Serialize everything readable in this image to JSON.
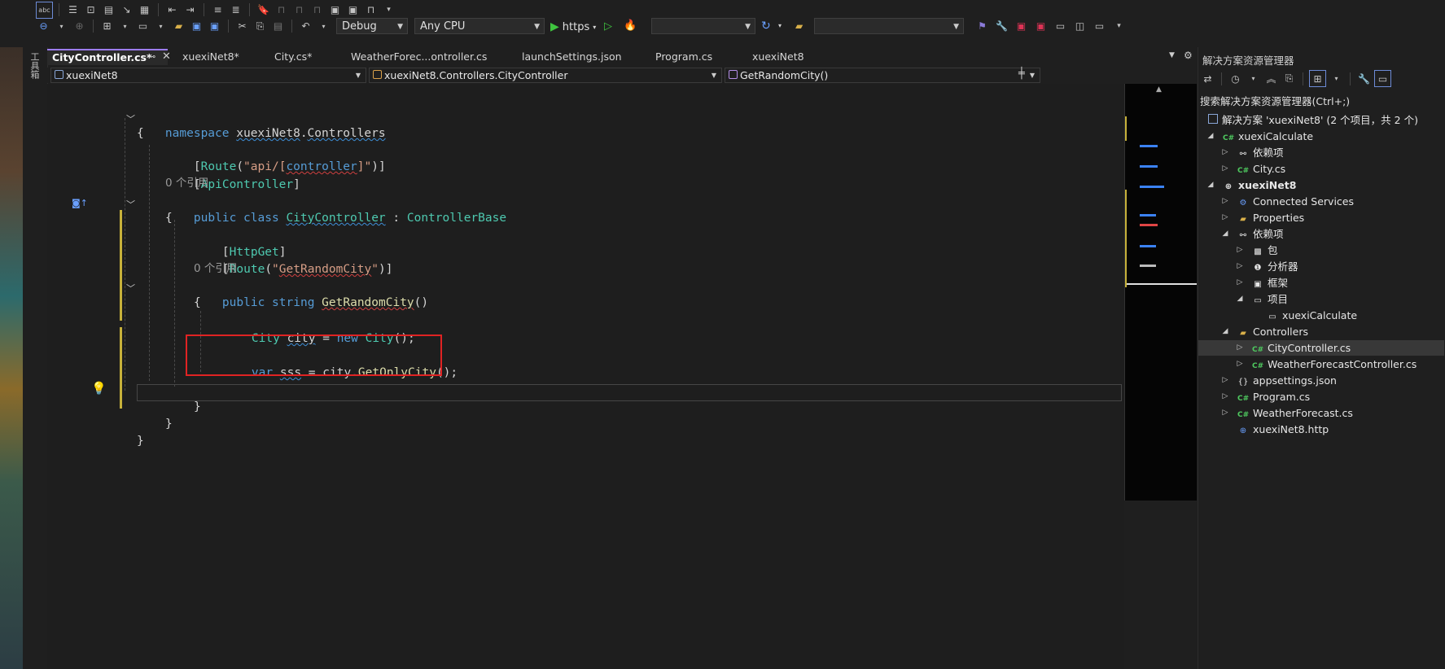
{
  "toolbar": {
    "config": "Debug",
    "platform": "Any CPU",
    "run_label": "https",
    "startup_combo": "",
    "search_combo": ""
  },
  "toolbox_label": "工具箱",
  "tabs": [
    {
      "label": "CityController.cs*",
      "active": true
    },
    {
      "label": "xuexiNet8*"
    },
    {
      "label": "City.cs*"
    },
    {
      "label": "WeatherForec...ontroller.cs"
    },
    {
      "label": "launchSettings.json"
    },
    {
      "label": "Program.cs"
    },
    {
      "label": "xuexiNet8"
    }
  ],
  "navbar": {
    "project": "xuexiNet8",
    "class": "xuexiNet8.Controllers.CityController",
    "member": "GetRandomCity()"
  },
  "code": {
    "l1_kw": "namespace",
    "l1_ns1": "xuexiNet8",
    "l1_dot": ".",
    "l1_ns2": "Controllers",
    "l2": "{",
    "l3_open": "[",
    "l3_attr": "Route",
    "l3_p1": "(",
    "l3_s1": "\"api/[",
    "l3_s2": "controller",
    "l3_s3": "]\"",
    "l3_close": ")]",
    "l4_open": "[",
    "l4_attr": "ApiController",
    "l4_close": "]",
    "l5_ref": "0 个引用",
    "l6_kw1": "public",
    "l6_kw2": "class",
    "l6_name": "CityController",
    "l6_colon": " : ",
    "l6_base": "ControllerBase",
    "l7": "{",
    "l8_open": "[",
    "l8_attr": "HttpGet",
    "l8_close": "]",
    "l9_open": "[",
    "l9_attr": "Route",
    "l9_p": "(",
    "l9_s1": "\"",
    "l9_s2": "GetRandomCity",
    "l9_s3": "\"",
    "l9_close": ")]",
    "l10_ref": "0 个引用",
    "l11_kw1": "public",
    "l11_kw2": "string",
    "l11_fn": "GetRandomCity",
    "l11_paren": "()",
    "l12": "{",
    "l13_type": "City",
    "l13_var": "city",
    "l13_eq": " = ",
    "l13_new": "new",
    "l13_ctor": "City",
    "l13_end": "();",
    "l14_kw": "var",
    "l14_var": "sss",
    "l14_eq": " = ",
    "l14_obj": "city",
    "l14_dot": ".",
    "l14_fn": "GetOnlyCity",
    "l14_end": "();",
    "l16": "}",
    "l17": "}",
    "l18": "}"
  },
  "solution_explorer": {
    "title": "解决方案资源管理器",
    "search_placeholder": "搜索解决方案资源管理器(Ctrl+;)",
    "solution": "解决方案 'xuexiNet8' (2 个项目，共 2 个)",
    "items": [
      {
        "label": "xuexiCalculate"
      },
      {
        "label": "依赖项"
      },
      {
        "label": "City.cs"
      },
      {
        "label": "xuexiNet8"
      },
      {
        "label": "Connected Services"
      },
      {
        "label": "Properties"
      },
      {
        "label": "依赖项"
      },
      {
        "label": "包"
      },
      {
        "label": "分析器"
      },
      {
        "label": "框架"
      },
      {
        "label": "项目"
      },
      {
        "label": "xuexiCalculate"
      },
      {
        "label": "Controllers"
      },
      {
        "label": "CityController.cs"
      },
      {
        "label": "WeatherForecastController.cs"
      },
      {
        "label": "appsettings.json"
      },
      {
        "label": "Program.cs"
      },
      {
        "label": "WeatherForecast.cs"
      },
      {
        "label": "xuexiNet8.http"
      }
    ]
  },
  "icons": {
    "cs_badge": "C#"
  }
}
